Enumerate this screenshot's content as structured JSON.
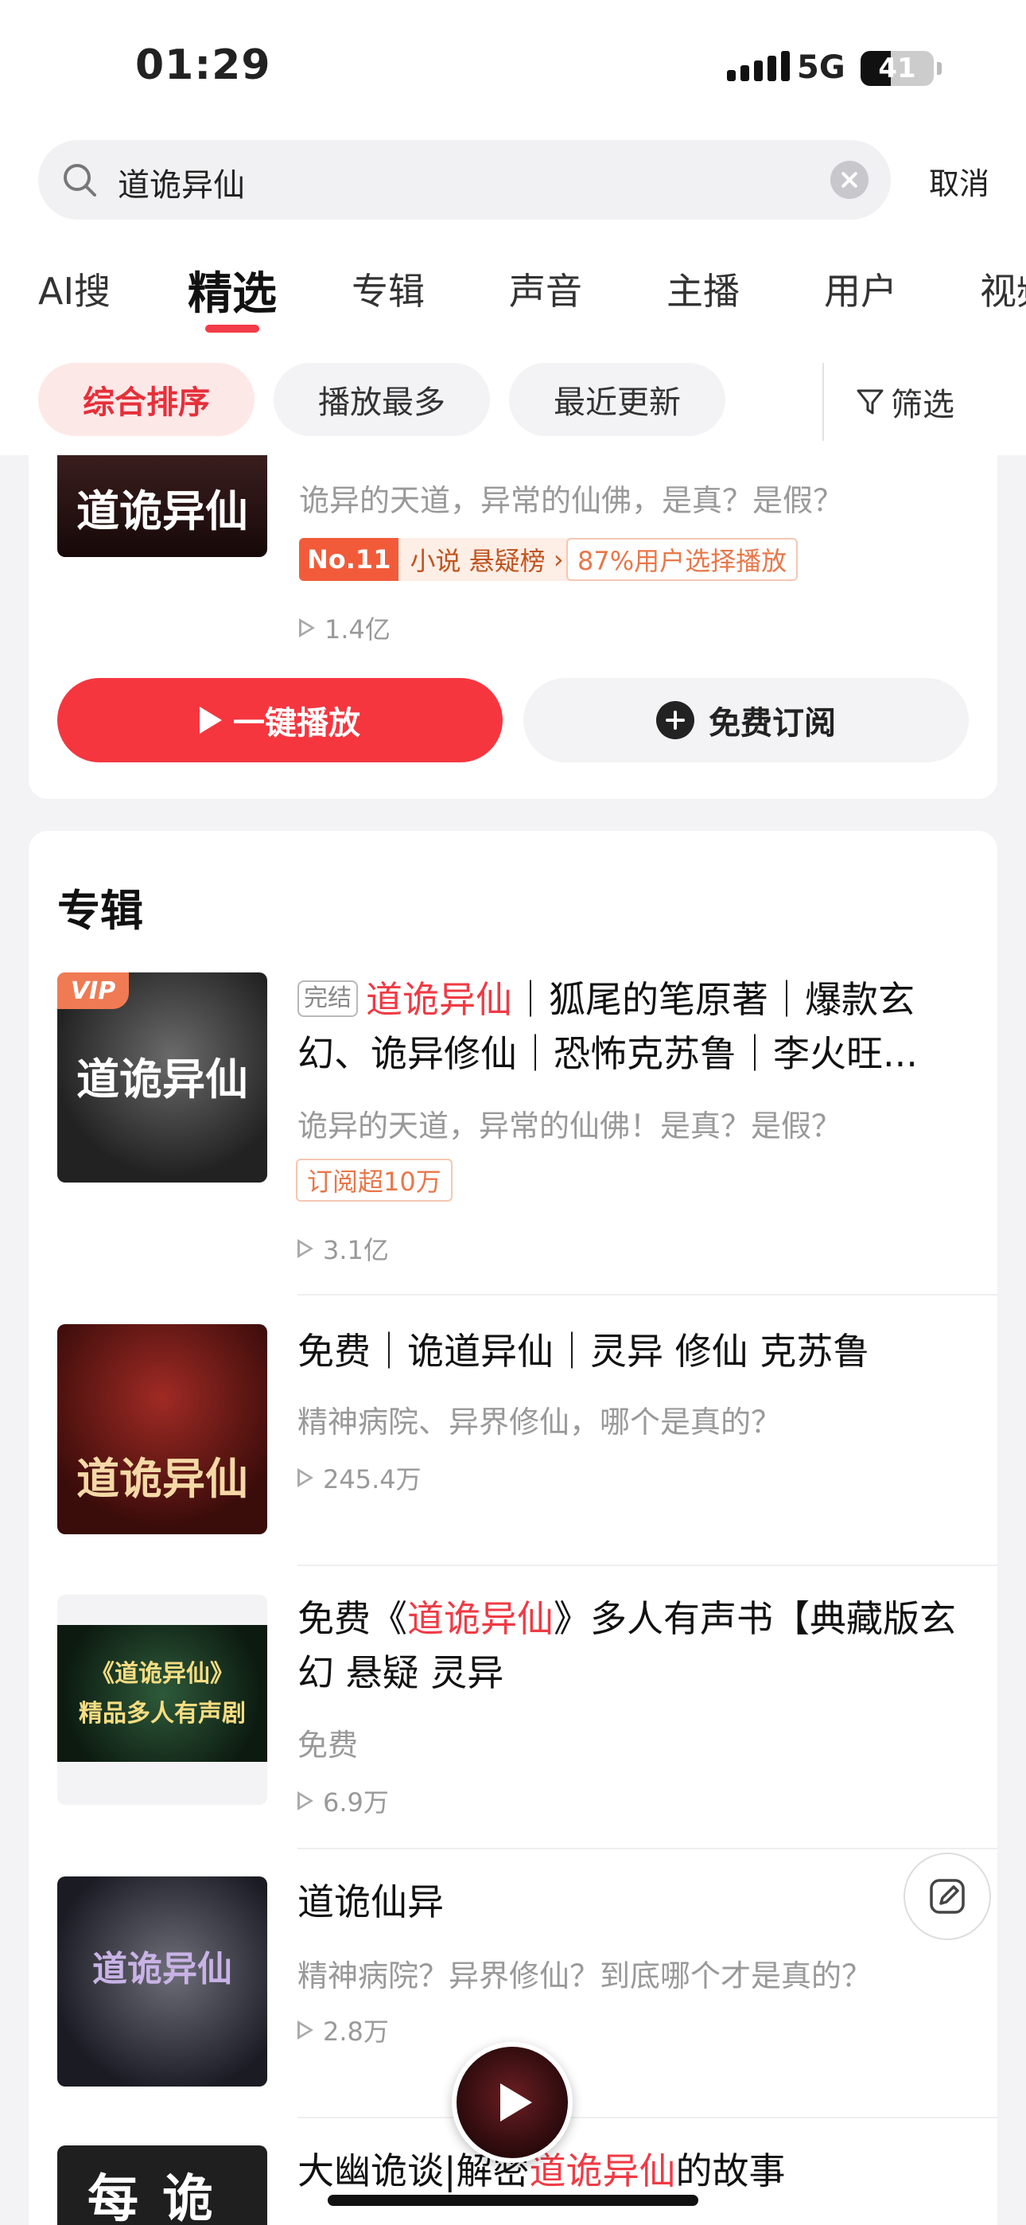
{
  "status": {
    "time": "01:29",
    "network": "5G",
    "battery": "41",
    "battery_level": 0.41
  },
  "search": {
    "query": "道诡异仙",
    "cancel": "取消"
  },
  "tabs": [
    "AI搜",
    "精选",
    "专辑",
    "声音",
    "主播",
    "用户",
    "视频"
  ],
  "active_tab": "精选",
  "sort": {
    "chips": [
      "综合排序",
      "播放最多",
      "最近更新"
    ],
    "filter": "筛选"
  },
  "top_item": {
    "cover_text": "道诡异仙",
    "desc": "诡异的天道，异常的仙佛，是真？是假？",
    "rank_no": "No.11",
    "rank_label": "小说 悬疑榜",
    "choice": "87%用户选择播放",
    "plays": "1.4亿",
    "play_all": "一键播放",
    "subscribe": "免费订阅"
  },
  "album_section": {
    "title": "专辑",
    "items": [
      {
        "vip": "VIP",
        "tag": "完结",
        "title_hl": "道诡异仙",
        "title_rest": "｜狐尾的笔原著｜爆款玄幻、诡异修仙｜恐怖克苏鲁｜李火旺...",
        "desc": "诡异的天道，异常的仙佛！是真？是假？",
        "badge": "订阅超10万",
        "plays": "3.1亿",
        "cover_text": "道诡异仙"
      },
      {
        "title": "免费｜诡道异仙｜灵异 修仙 克苏鲁",
        "desc": "精神病院、异界修仙，哪个是真的？",
        "plays": "245.4万",
        "cover_text": "道诡异仙"
      },
      {
        "title_pre": "免费《",
        "title_hl": "道诡异仙",
        "title_rest": "》多人有声书【典藏版玄幻 悬疑 灵异",
        "desc": "免费",
        "plays": "6.9万",
        "cover_line1": "《道诡异仙》",
        "cover_line2": "精品多人有声剧"
      },
      {
        "title": "道诡仙异",
        "desc": "精神病院？异界修仙？到底哪个才是真的？",
        "plays": "2.8万",
        "cover_text": "道诡异仙"
      },
      {
        "title_pre": "大幽诡谈|解密",
        "title_hl": "道诡异仙",
        "title_rest": "的故事",
        "cover_text": "每诡"
      }
    ]
  },
  "icons": [
    "search-icon",
    "clear-icon",
    "filter-icon",
    "play-icon",
    "plus-circle-icon",
    "edit-icon"
  ]
}
